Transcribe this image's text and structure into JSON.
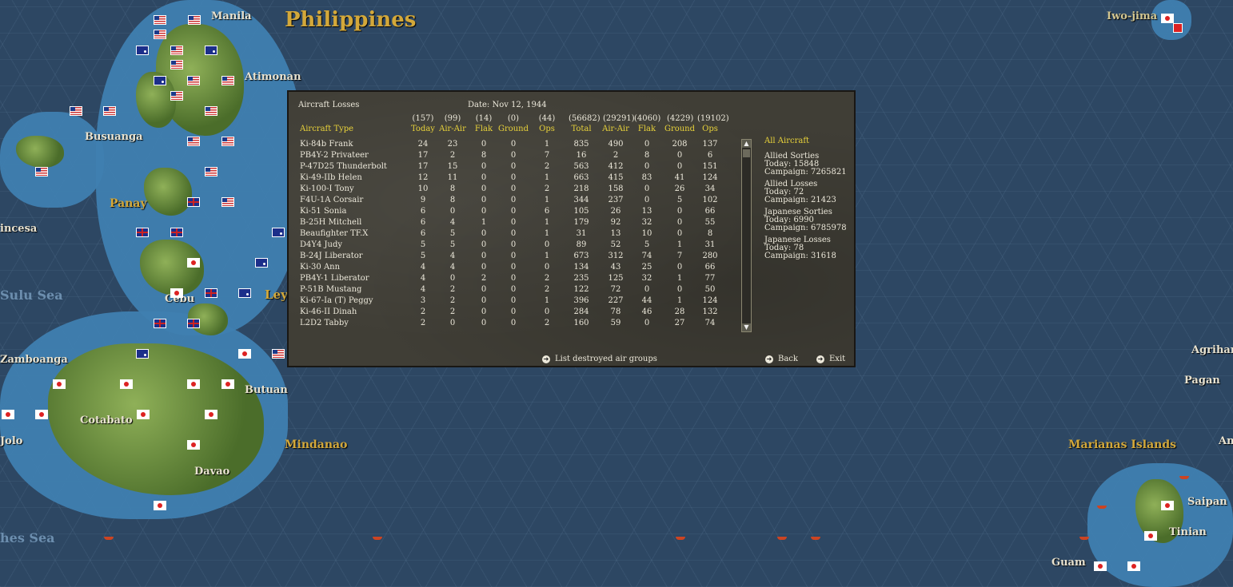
{
  "map": {
    "region_title": "Philippines",
    "places": [
      "Manila",
      "Atimonan",
      "Busuanga",
      "Panay",
      "incesa",
      "Sulu Sea",
      "Cebu",
      "Ley",
      "Zamboanga",
      "Butuan",
      "Cotabato",
      "Jolo",
      "Mindanao",
      "Davao",
      "Iwo-jima",
      "Agrihan",
      "Pagan",
      "Marianas Islands",
      "An",
      "Saipan",
      "Tinian",
      "Guam",
      "hes Sea"
    ]
  },
  "dialog": {
    "title": "Aircraft Losses",
    "date": "Date: Nov 12, 1944",
    "col_type_label": "Aircraft Type",
    "columns": [
      {
        "num": "(157)",
        "label": "Today"
      },
      {
        "num": "(99)",
        "label": "Air-Air"
      },
      {
        "num": "(14)",
        "label": "Flak"
      },
      {
        "num": "(0)",
        "label": "Ground"
      },
      {
        "num": "(44)",
        "label": "Ops"
      },
      {
        "num": "(56682)",
        "label": "Total"
      },
      {
        "num": "(29291)",
        "label": "Air-Air"
      },
      {
        "num": "(4060)",
        "label": "Flak"
      },
      {
        "num": "(4229)",
        "label": "Ground"
      },
      {
        "num": "(19102)",
        "label": "Ops"
      }
    ],
    "rows": [
      [
        "Ki-84b Frank",
        "24",
        "23",
        "0",
        "0",
        "1",
        "835",
        "490",
        "0",
        "208",
        "137"
      ],
      [
        "PB4Y-2 Privateer",
        "17",
        "2",
        "8",
        "0",
        "7",
        "16",
        "2",
        "8",
        "0",
        "6"
      ],
      [
        "P-47D25 Thunderbolt",
        "17",
        "15",
        "0",
        "0",
        "2",
        "563",
        "412",
        "0",
        "0",
        "151"
      ],
      [
        "Ki-49-IIb Helen",
        "12",
        "11",
        "0",
        "0",
        "1",
        "663",
        "415",
        "83",
        "41",
        "124"
      ],
      [
        "Ki-100-I Tony",
        "10",
        "8",
        "0",
        "0",
        "2",
        "218",
        "158",
        "0",
        "26",
        "34"
      ],
      [
        "F4U-1A Corsair",
        "9",
        "8",
        "0",
        "0",
        "1",
        "344",
        "237",
        "0",
        "5",
        "102"
      ],
      [
        "Ki-51 Sonia",
        "6",
        "0",
        "0",
        "0",
        "6",
        "105",
        "26",
        "13",
        "0",
        "66"
      ],
      [
        "B-25H Mitchell",
        "6",
        "4",
        "1",
        "0",
        "1",
        "179",
        "92",
        "32",
        "0",
        "55"
      ],
      [
        "Beaufighter TF.X",
        "6",
        "5",
        "0",
        "0",
        "1",
        "31",
        "13",
        "10",
        "0",
        "8"
      ],
      [
        "D4Y4 Judy",
        "5",
        "5",
        "0",
        "0",
        "0",
        "89",
        "52",
        "5",
        "1",
        "31"
      ],
      [
        "B-24J Liberator",
        "5",
        "4",
        "0",
        "0",
        "1",
        "673",
        "312",
        "74",
        "7",
        "280"
      ],
      [
        "Ki-30 Ann",
        "4",
        "4",
        "0",
        "0",
        "0",
        "134",
        "43",
        "25",
        "0",
        "66"
      ],
      [
        "PB4Y-1 Liberator",
        "4",
        "0",
        "2",
        "0",
        "2",
        "235",
        "125",
        "32",
        "1",
        "77"
      ],
      [
        "P-51B Mustang",
        "4",
        "2",
        "0",
        "0",
        "2",
        "122",
        "72",
        "0",
        "0",
        "50"
      ],
      [
        "Ki-67-Ia (T) Peggy",
        "3",
        "2",
        "0",
        "0",
        "1",
        "396",
        "227",
        "44",
        "1",
        "124"
      ],
      [
        "Ki-46-II Dinah",
        "2",
        "2",
        "0",
        "0",
        "0",
        "284",
        "78",
        "46",
        "28",
        "132"
      ],
      [
        "L2D2 Tabby",
        "2",
        "0",
        "0",
        "0",
        "2",
        "160",
        "59",
        "0",
        "27",
        "74"
      ]
    ],
    "side": {
      "filter": "All Aircraft",
      "allied_sorties": {
        "title": "Allied Sorties",
        "today": "Today:   15848",
        "campaign": "Campaign: 7265821"
      },
      "allied_losses": {
        "title": "Allied Losses",
        "today": "Today:   72",
        "campaign": "Campaign: 21423"
      },
      "japanese_sorties": {
        "title": "Japanese Sorties",
        "today": "Today:   6990",
        "campaign": "Campaign: 6785978"
      },
      "japanese_losses": {
        "title": "Japanese Losses",
        "today": "Today:   78",
        "campaign": "Campaign: 31618"
      }
    },
    "buttons": {
      "list_destroyed": "List destroyed air groups",
      "back": "Back",
      "exit": "Exit"
    }
  }
}
